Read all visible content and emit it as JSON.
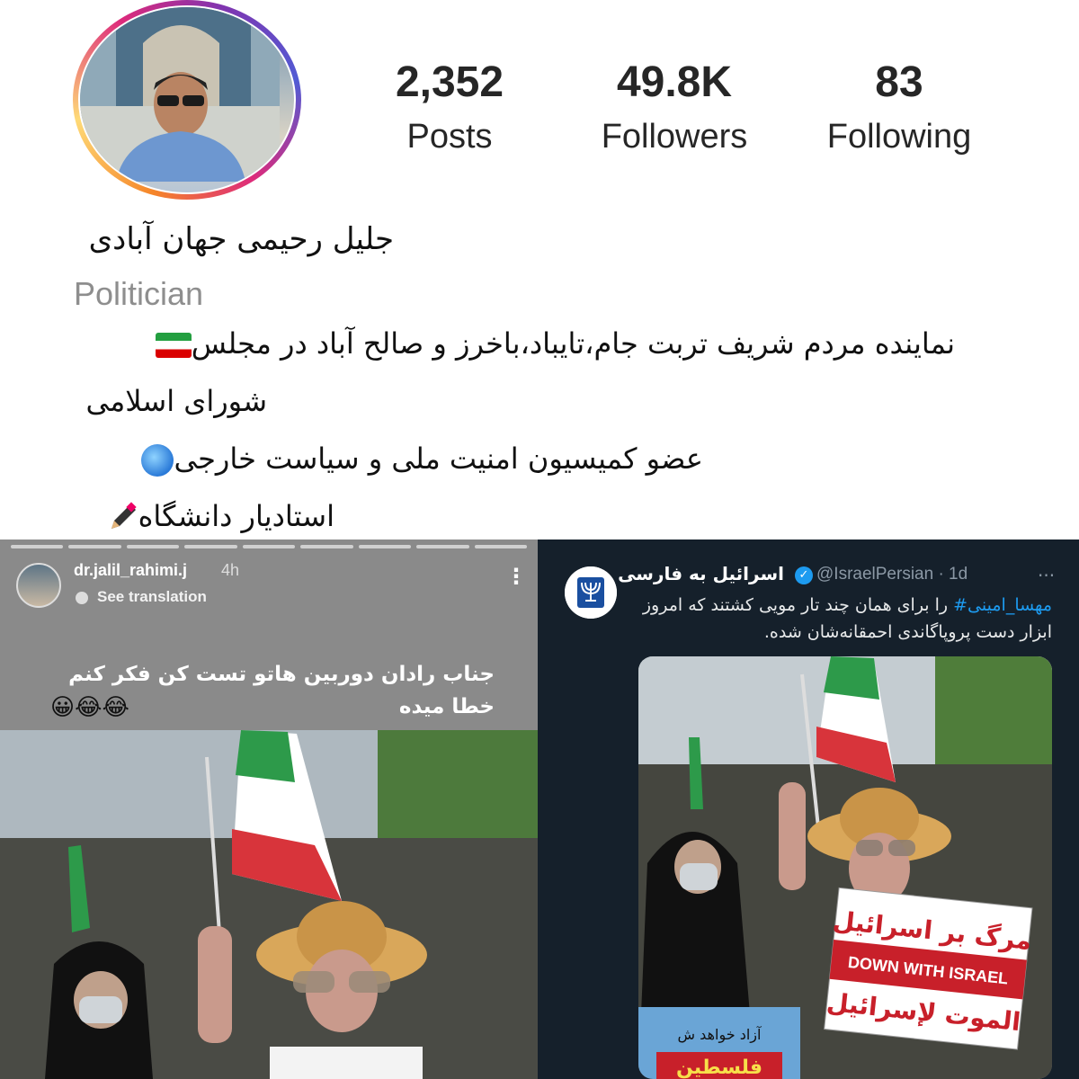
{
  "profile": {
    "name": "جلیل رحیمی جهان آبادی",
    "category": "Politician",
    "stats": [
      {
        "value": "2,352",
        "label": "Posts"
      },
      {
        "value": "49.8K",
        "label": "Followers"
      },
      {
        "value": "83",
        "label": "Following"
      }
    ],
    "bio": [
      "نماینده مردم شریف تربت جام،تایباد،باخرز و صالح آباد در مجلس",
      "شورای اسلامی",
      "عضو کمیسیون امنیت ملی و سیاست خارجی",
      "استادیار دانشگاه"
    ],
    "bio_icons": [
      "iran-flag-icon",
      "globe-icon",
      "pencil-icon"
    ]
  },
  "story": {
    "username": "dr.jalil_rahimi.j",
    "time": "4h",
    "translate_label": "See translation",
    "caption": "جناب رادان دوربین هاتو تست کن فکر کنم خطا میده",
    "emojis": "😀😂😂"
  },
  "tweet": {
    "name": "اسرائیل به فارسی",
    "handle": "@IsraelPersian · 1d",
    "hashtag": "مهسا_امینی#",
    "text_after_tag": " را برای همان چند تار مویی کشتند که امروز ابزار دست پروپاگاندی احمقانه‌شان شده.",
    "sign": {
      "line1": "مرگ بر اسرائیل",
      "line2": "DOWN WITH ISRAEL",
      "line3": "الموت لإسرائيل"
    },
    "small_sign": {
      "line1": "آزاد خواهد ش",
      "line2": "فلسطین"
    }
  },
  "colors": {
    "instagram_ring": [
      "#f58529",
      "#dd2a7b",
      "#8134af",
      "#515bd4"
    ],
    "twitter_bg": "#15202b",
    "twitter_blue": "#1d9bf0",
    "flag_green": "#239f40",
    "flag_red": "#da0000"
  }
}
